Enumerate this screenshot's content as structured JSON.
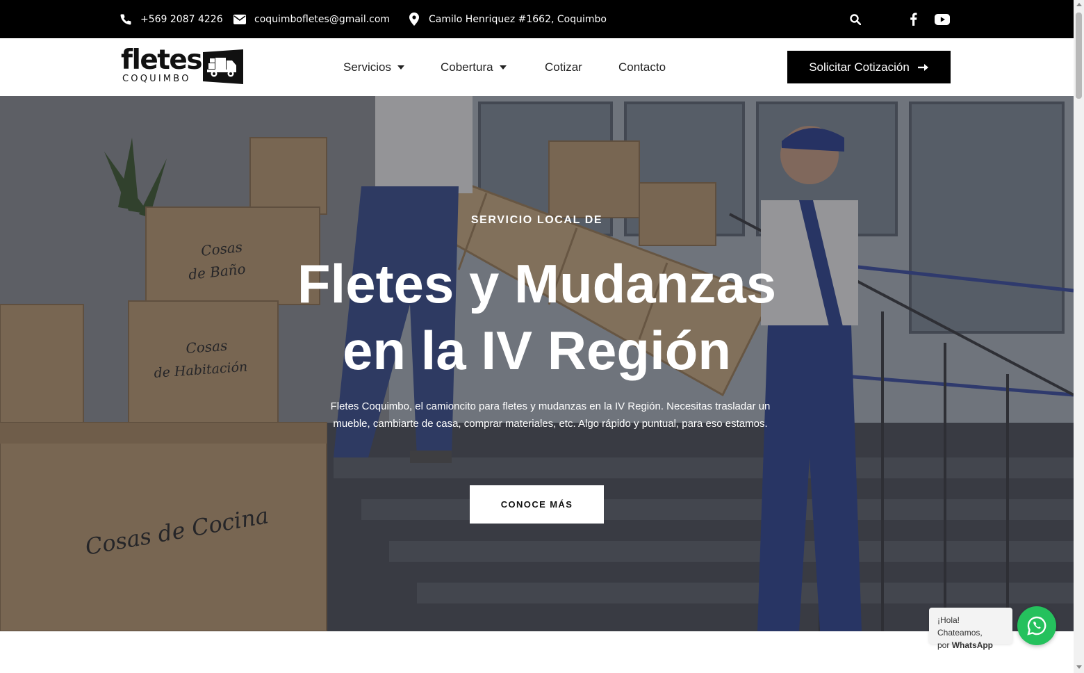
{
  "topbar": {
    "phone": "+569 2087 4226",
    "email": "coquimbofletes@gmail.com",
    "address": "Camilo Henriquez #1662, Coquimbo",
    "icons": [
      "phone-icon",
      "envelope-icon",
      "map-pin-icon",
      "search-icon",
      "facebook-icon",
      "youtube-icon"
    ]
  },
  "header": {
    "logo": {
      "main": "fletes",
      "sub": "COQUIMBO"
    },
    "nav": [
      {
        "label": "Servicios",
        "has_dropdown": true
      },
      {
        "label": "Cobertura",
        "has_dropdown": true
      },
      {
        "label": "Cotizar",
        "has_dropdown": false
      },
      {
        "label": "Contacto",
        "has_dropdown": false
      }
    ],
    "cta_label": "Solicitar Cotización"
  },
  "hero": {
    "eyebrow": "SERVICIO LOCAL DE",
    "title_line1": "Fletes y Mudanzas",
    "title_line2": "en la IV Región",
    "description": "Fletes Coquimbo, el camioncito para fletes y mudanzas en la IV Región. Necesitas trasladar un mueble, cambiarte de casa, comprar materiales, etc. Algo rápido y puntual, para eso estamos.",
    "button_label": "CONOCE MÁS",
    "box_labels": [
      "Cosas de Baño",
      "Cosas de Habitación",
      "Cosas de Cocina"
    ]
  },
  "whatsapp": {
    "line1": "¡Hola! Chateamos,",
    "line2_prefix": "por",
    "line2_brand": "WhatsApp"
  },
  "colors": {
    "topbar_bg": "#000000",
    "cta_bg": "#000000",
    "whatsapp_green": "#25c15d",
    "hero_text": "#ffffff"
  }
}
